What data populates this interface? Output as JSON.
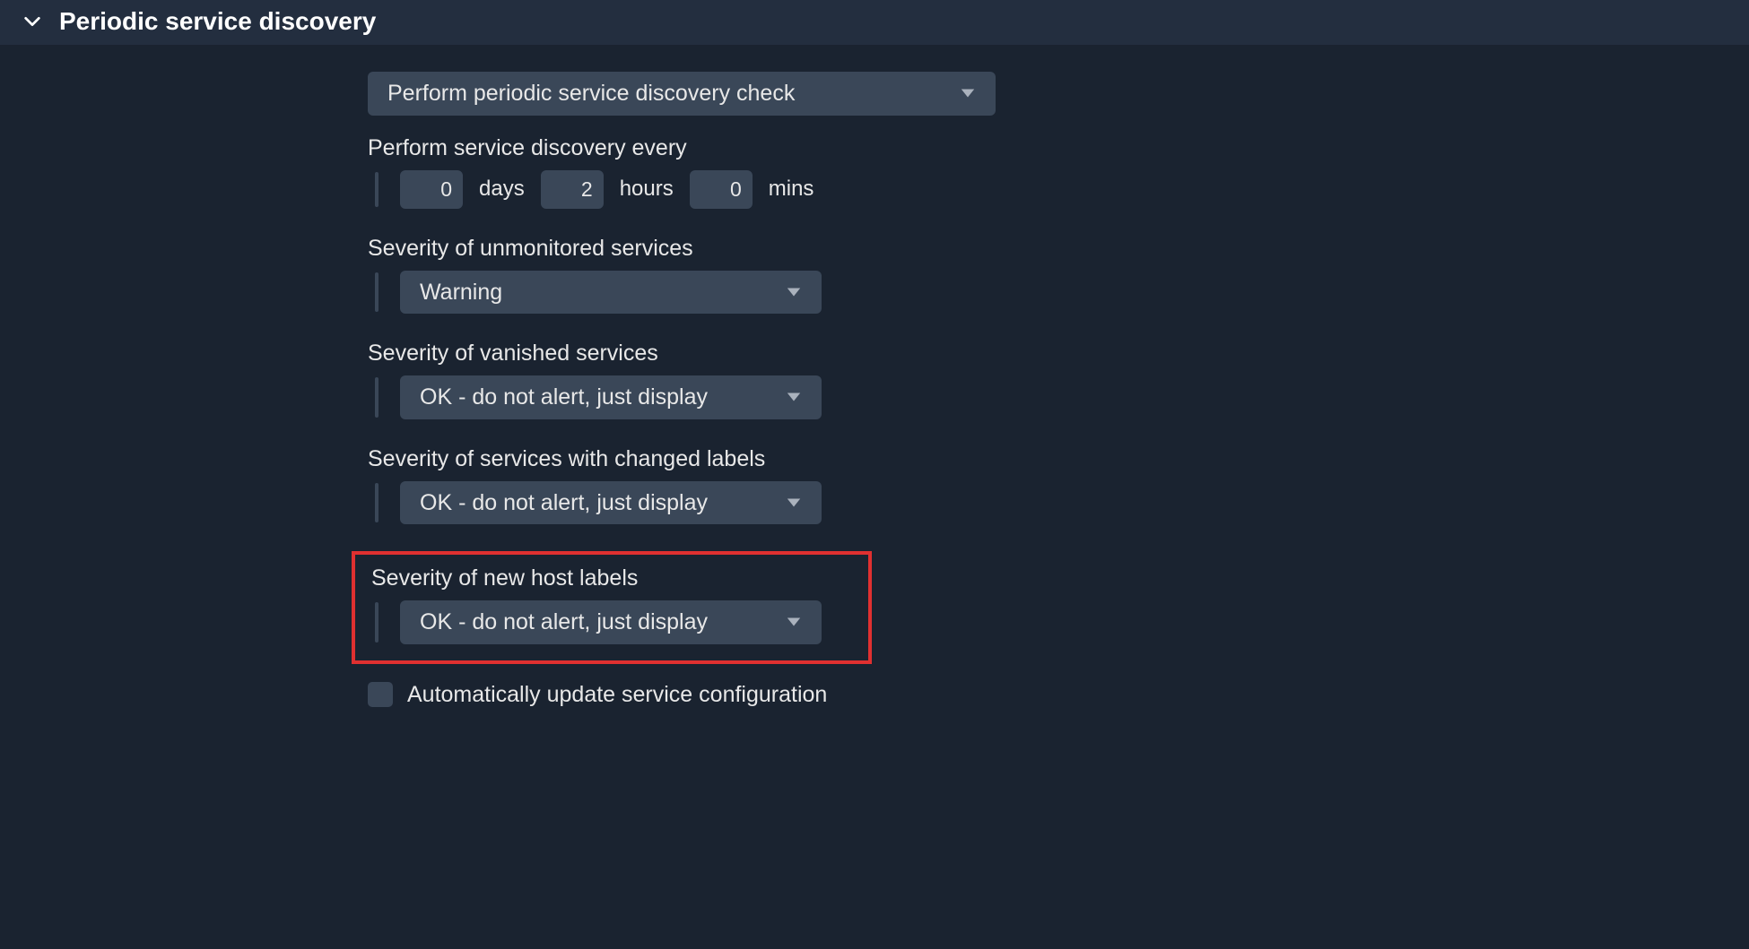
{
  "section": {
    "title": "Periodic service discovery"
  },
  "mode_dropdown": {
    "value": "Perform periodic service discovery check"
  },
  "interval": {
    "label": "Perform service discovery every",
    "days": "0",
    "days_unit": "days",
    "hours": "2",
    "hours_unit": "hours",
    "mins": "0",
    "mins_unit": "mins"
  },
  "sev_unmonitored": {
    "label": "Severity of unmonitored services",
    "value": "Warning"
  },
  "sev_vanished": {
    "label": "Severity of vanished services",
    "value": "OK - do not alert, just display"
  },
  "sev_changed_labels": {
    "label": "Severity of services with changed labels",
    "value": "OK - do not alert, just display"
  },
  "sev_new_host_labels": {
    "label": "Severity of new host labels",
    "value": "OK - do not alert, just display"
  },
  "auto_update": {
    "label": "Automatically update service configuration"
  }
}
